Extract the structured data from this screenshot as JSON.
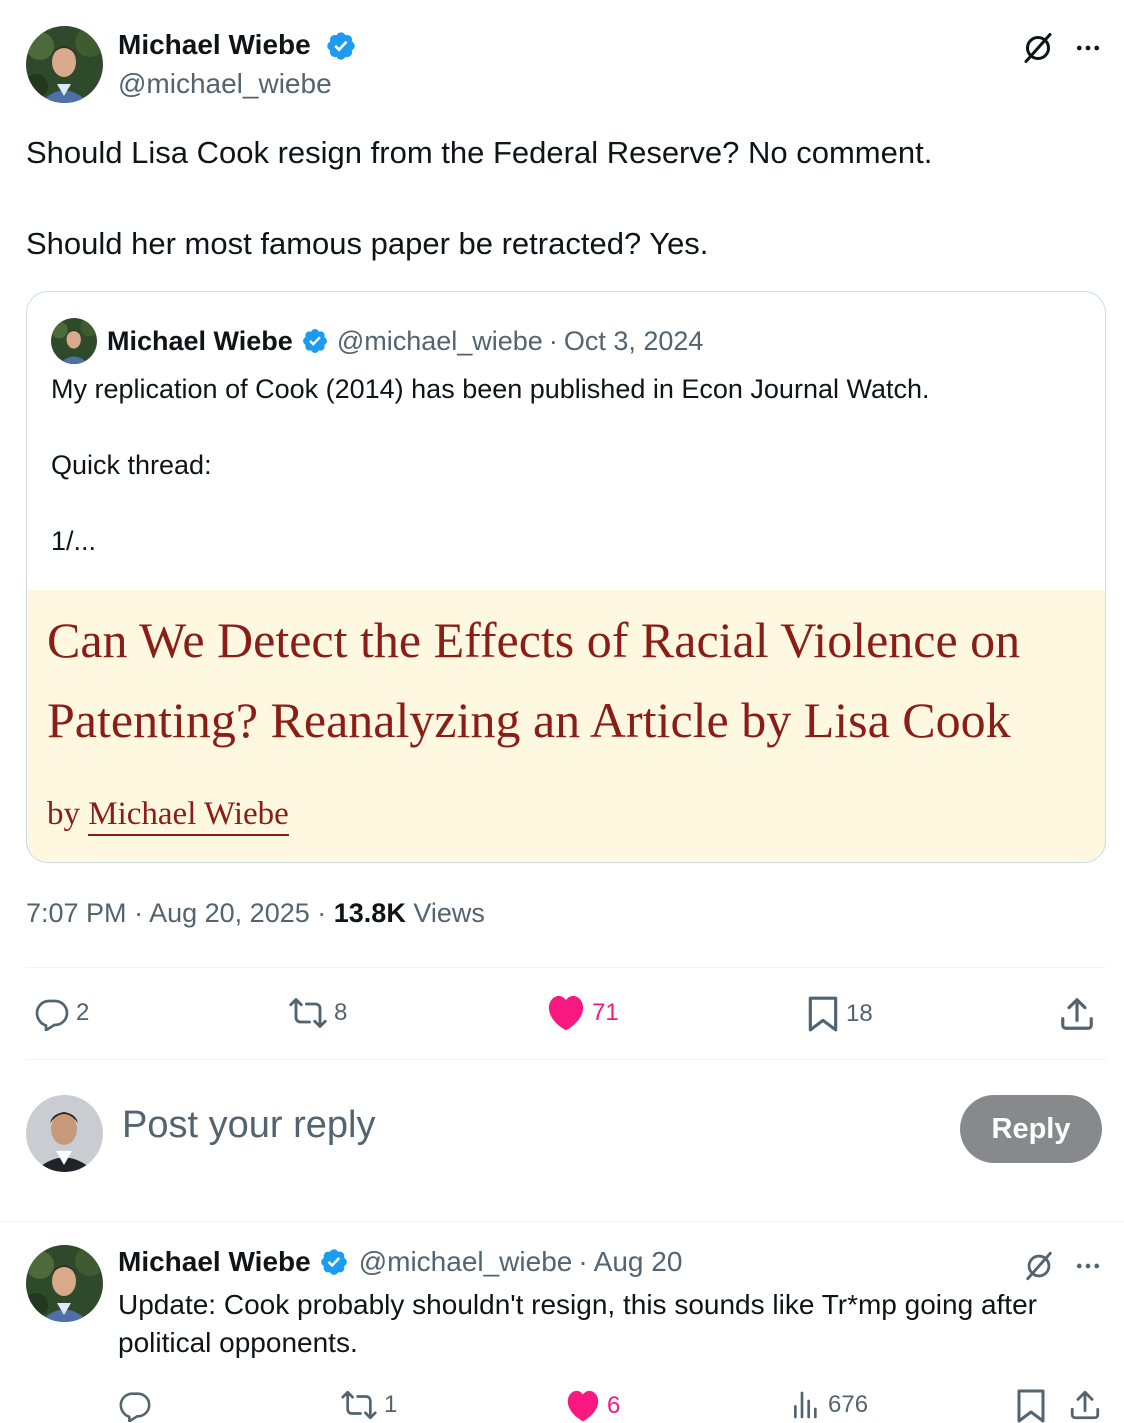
{
  "colors": {
    "accent_blue": "#1d9bf0",
    "like_pink": "#f91880",
    "secondary_text": "#536471",
    "paper_red": "#8a1d17",
    "paper_bg": "#fdf8df",
    "reply_button_bg": "#87898c"
  },
  "tweet": {
    "author_name": "Michael Wiebe",
    "author_handle": "@michael_wiebe",
    "text_line1": "Should Lisa Cook resign from the Federal Reserve? No comment.",
    "text_line2": "Should her most famous paper be retracted? Yes.",
    "time": "7:07 PM",
    "date": "Aug 20, 2025",
    "views_count": "13.8K",
    "views_label": "Views",
    "replies": "2",
    "reposts": "8",
    "likes": "71",
    "bookmarks": "18",
    "icons": [
      "no-translate-icon",
      "more-icon",
      "reply-icon",
      "repost-icon",
      "heart-icon",
      "bookmark-icon",
      "share-icon",
      "verified-icon"
    ]
  },
  "quote": {
    "author_name": "Michael Wiebe",
    "author_handle": "@michael_wiebe",
    "date": "Oct 3, 2024",
    "line1": "My replication of Cook (2014) has been published in Econ Journal Watch.",
    "line2": "Quick thread:",
    "line3": "1/...",
    "paper_title_line1": "Can We Detect the Effects of Racial Violence on",
    "paper_title_line2": "Patenting? Reanalyzing an Article by Lisa Cook",
    "paper_by": "by",
    "paper_author": "Michael Wiebe"
  },
  "composer": {
    "placeholder": "Post your reply",
    "button_label": "Reply"
  },
  "reply": {
    "author_name": "Michael Wiebe",
    "author_handle": "@michael_wiebe",
    "date": "Aug 20",
    "text": "Update: Cook probably shouldn't resign, this sounds like Tr*mp going after political opponents.",
    "replies": "",
    "reposts": "1",
    "likes": "6",
    "views": "676"
  }
}
